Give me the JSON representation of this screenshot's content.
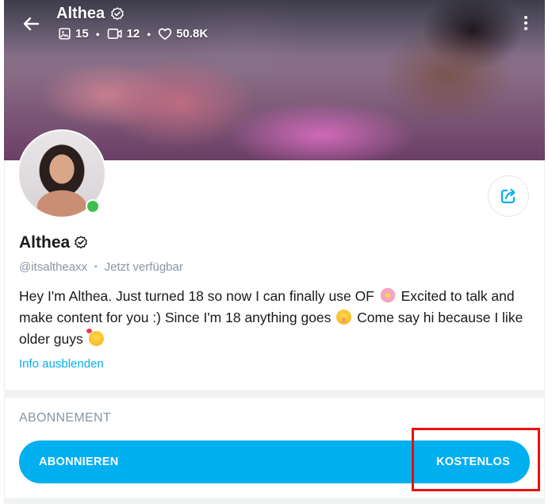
{
  "header": {
    "title": "Althea",
    "stats": {
      "photos": "15",
      "videos": "12",
      "likes": "50.8K"
    }
  },
  "profile": {
    "name": "Althea",
    "handle": "@itsaltheaxx",
    "status": "Jetzt verfügbar",
    "bio_line1": "Hey I'm Althea. Just turned 18 so now I can finally use OF",
    "bio_line2": "Excited to talk and make content for you :) Since I'm 18 anything goes",
    "bio_line3": "Come say hi because I like older guys",
    "toggle_info": "Info ausblenden",
    "online": true
  },
  "subscription": {
    "section_title": "ABONNEMENT",
    "button_label": "ABONNIEREN",
    "price_label": "KOSTENLOS"
  },
  "colors": {
    "accent": "#00aff0",
    "online": "#3dbf4f",
    "highlight": "#e81010",
    "muted": "#8a96a3"
  },
  "icons": {
    "back": "arrow-left",
    "verified": "verified-badge",
    "photos": "image",
    "videos": "video-camera",
    "likes": "heart-outline",
    "more": "dots-vertical",
    "share": "share-box-arrow"
  }
}
